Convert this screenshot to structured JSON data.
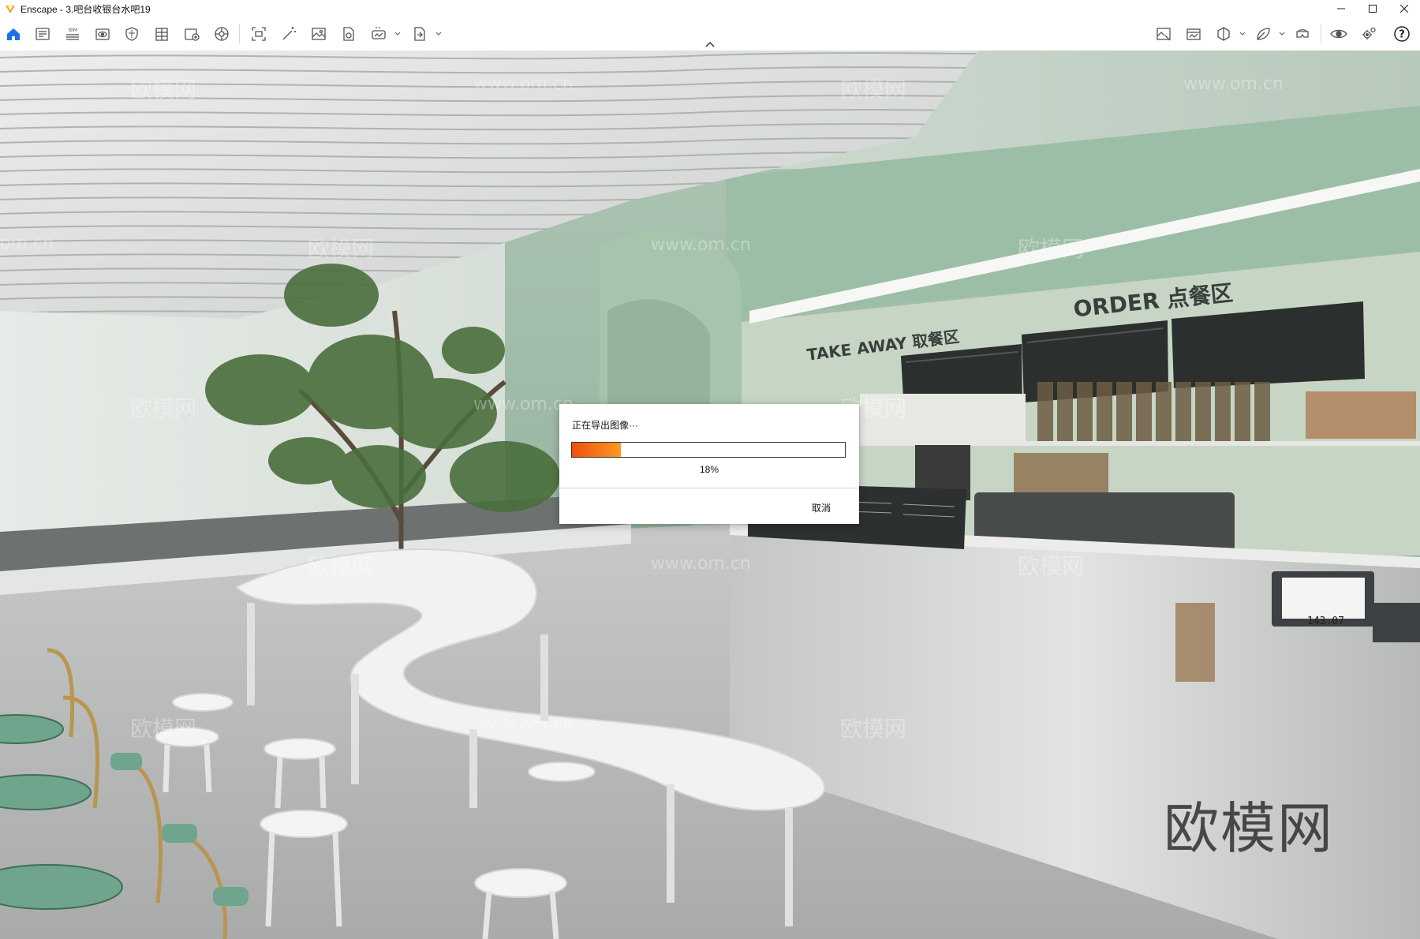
{
  "window": {
    "title": "Enscape - 3.吧台收银台水吧19",
    "app_logo_icon": "enscape-logo-icon",
    "controls": [
      "minimize-icon",
      "maximize-icon",
      "close-icon"
    ]
  },
  "toolbar": {
    "bim_label": "BIM",
    "accent_color": "#1a73e8",
    "left_icons": [
      "home-icon",
      "document-icon",
      "bim-list-icon",
      "visual-settings-icon",
      "shield-icon",
      "building-icon",
      "asset-library-icon",
      "material-sphere-icon",
      "screenshot-icon",
      "magic-wand-icon",
      "image-icon",
      "video-file-icon",
      "panorama-export-icon",
      "export-file-icon"
    ],
    "right_icons": [
      "view-management-icon",
      "image-gallery-icon",
      "cube-view-icon",
      "leaf-icon",
      "vr-headset-icon",
      "eye-icon",
      "settings-icon",
      "help-icon"
    ],
    "collapse_icon": "chevron-up-icon"
  },
  "scene": {
    "sign_order": "ORDER 点餐区",
    "sign_takeaway": "TAKE AWAY 取餐区",
    "register_amount": "143.07",
    "watermark_big": "欧模网",
    "watermark_small": "欧模网",
    "watermark_url": "www.om.cn",
    "watermark_url_short": "om.cn"
  },
  "dialog": {
    "message": "正在导出图像···",
    "progress": 0.18,
    "progress_label": "18%",
    "cancel_label": "取消",
    "progress_colors": [
      "#f0500e",
      "#fb9a21"
    ]
  }
}
